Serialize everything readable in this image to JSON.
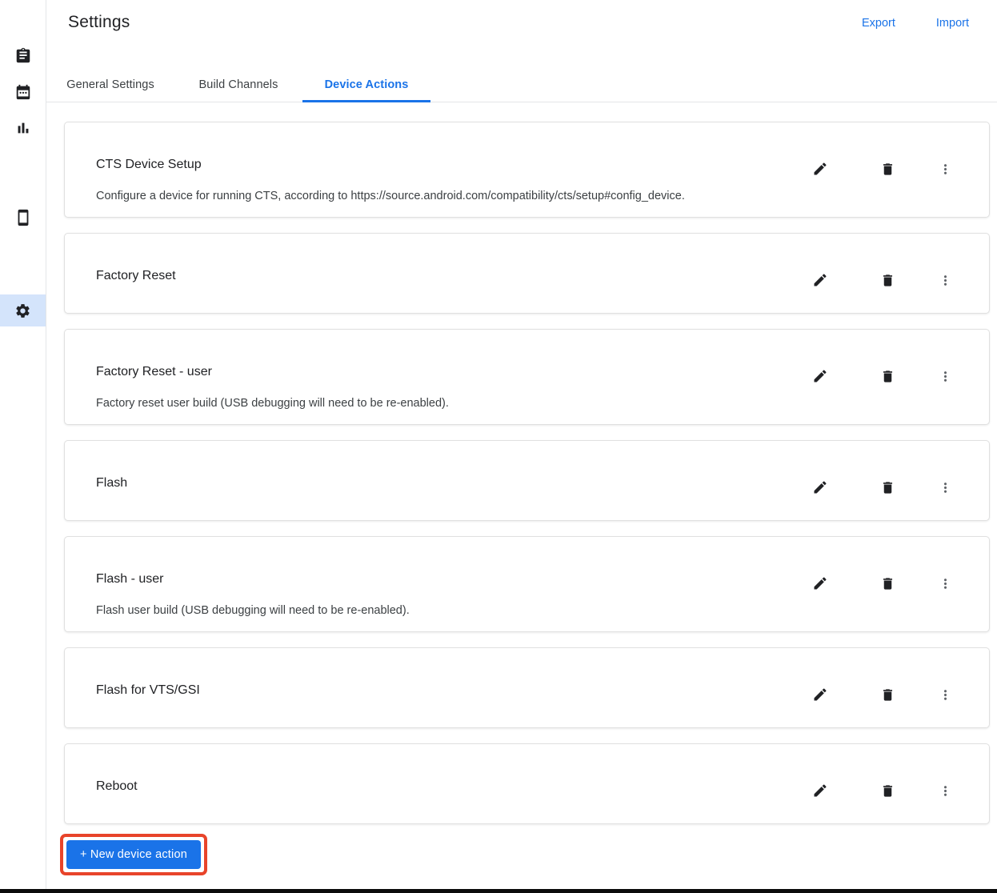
{
  "header": {
    "title": "Settings",
    "export_label": "Export",
    "import_label": "Import"
  },
  "tabs": [
    {
      "label": "General Settings",
      "active": false
    },
    {
      "label": "Build Channels",
      "active": false
    },
    {
      "label": "Device Actions",
      "active": true
    }
  ],
  "sidebar": {
    "items": [
      {
        "icon": "clipboard-icon",
        "selected": false
      },
      {
        "icon": "calendar-icon",
        "selected": false
      },
      {
        "icon": "bar-chart-icon",
        "selected": false
      },
      {
        "icon": "smartphone-icon",
        "selected": false
      },
      {
        "icon": "gear-icon",
        "selected": true
      }
    ]
  },
  "device_actions": [
    {
      "name": "CTS Device Setup",
      "description": "Configure a device for running CTS, according to https://source.android.com/compatibility/cts/setup#config_device."
    },
    {
      "name": "Factory Reset",
      "description": ""
    },
    {
      "name": "Factory Reset - user",
      "description": "Factory reset user build (USB debugging will need to be re-enabled)."
    },
    {
      "name": "Flash",
      "description": ""
    },
    {
      "name": "Flash - user",
      "description": "Flash user build (USB debugging will need to be re-enabled)."
    },
    {
      "name": "Flash for VTS/GSI",
      "description": ""
    },
    {
      "name": "Reboot",
      "description": ""
    }
  ],
  "footer": {
    "new_device_action_label": "+ New device action"
  },
  "colors": {
    "accent_blue": "#1a73e8",
    "annotation_red": "#e8442a",
    "selected_item_bg": "#d4e4fb",
    "card_border": "#e0e0e0"
  }
}
